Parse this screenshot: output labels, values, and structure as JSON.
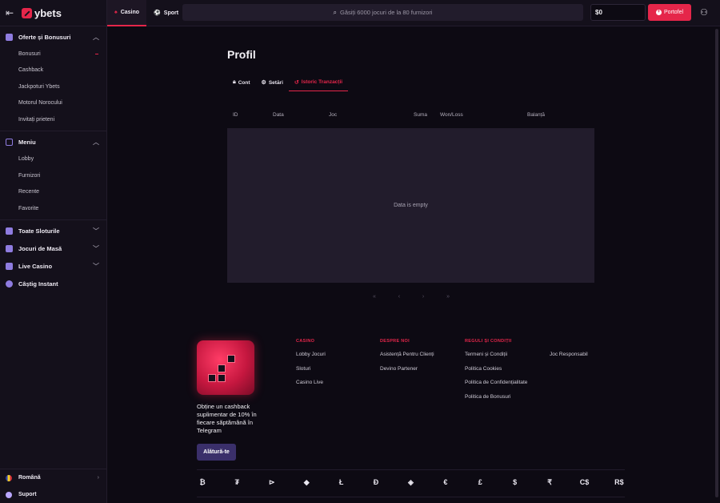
{
  "brand": {
    "name": "ybets",
    "accent": "#e5264a"
  },
  "sidebar": {
    "groups": [
      {
        "title": "Oferte și Bonusuri",
        "icon": "gift-icon",
        "items": [
          "Bonusuri",
          "Cashback",
          "Jackpoturi Ybets",
          "Motorul Norocului",
          "Invitați prieteni"
        ]
      },
      {
        "title": "Meniu",
        "icon": "menu-icon",
        "items": [
          "Lobby",
          "Furnizori",
          "Recente",
          "Favorite"
        ]
      }
    ],
    "sections": [
      {
        "title": "Toate Sloturile",
        "icon": "grid-icon"
      },
      {
        "title": "Jocuri de Masă",
        "icon": "table-games-icon"
      },
      {
        "title": "Live Casino",
        "icon": "live-icon"
      },
      {
        "title": "Câștig Instant",
        "icon": "instant-icon"
      }
    ],
    "language": "Română",
    "support": "Suport"
  },
  "topbar": {
    "tabs": [
      {
        "label": "Casino",
        "active": true
      },
      {
        "label": "Sport",
        "active": false
      }
    ],
    "search_placeholder": "Găsiți 6000 jocuri de la 80 furnizori",
    "balance": "$0",
    "wallet_label": "Portofel"
  },
  "profile": {
    "title": "Profil",
    "tabs": [
      {
        "label": "Cont",
        "icon": "lock-icon",
        "active": false
      },
      {
        "label": "Setări",
        "icon": "gear-icon",
        "active": false
      },
      {
        "label": "Istoric Tranzacții",
        "icon": "history-icon",
        "active": true
      }
    ],
    "table": {
      "columns": [
        "ID",
        "Data",
        "Joc",
        "Suma",
        "Won/Loss",
        "Balanță"
      ],
      "empty_text": "Data is empty"
    },
    "pager": [
      "«",
      "‹",
      "›",
      "»"
    ]
  },
  "footer": {
    "promo_text": "Obține un cashback suplimentar de 10% în fiecare săptămână în Telegram",
    "join_label": "Alătură-te",
    "columns": [
      {
        "heading": "CASINO",
        "links": [
          "Lobby Jocuri",
          "Sloturi",
          "Casino Live"
        ]
      },
      {
        "heading": "DESPRE NOI",
        "links": [
          "Asistență Pentru Clienți",
          "Devino Partener"
        ]
      },
      {
        "heading": "REGULI ȘI CONDIȚII",
        "links": [
          "Termeni și Condiții",
          "Politica Cookies",
          "Politica de Confidențialitate",
          "Politica de Bonusuri"
        ]
      },
      {
        "heading": "",
        "links": [
          "Joc Responsabil"
        ]
      }
    ],
    "currencies": [
      "₿",
      "₮",
      "⊳",
      "◆",
      "Ł",
      "Đ",
      "◈",
      "€",
      "£",
      "$",
      "₹",
      "C$",
      "R$"
    ]
  }
}
